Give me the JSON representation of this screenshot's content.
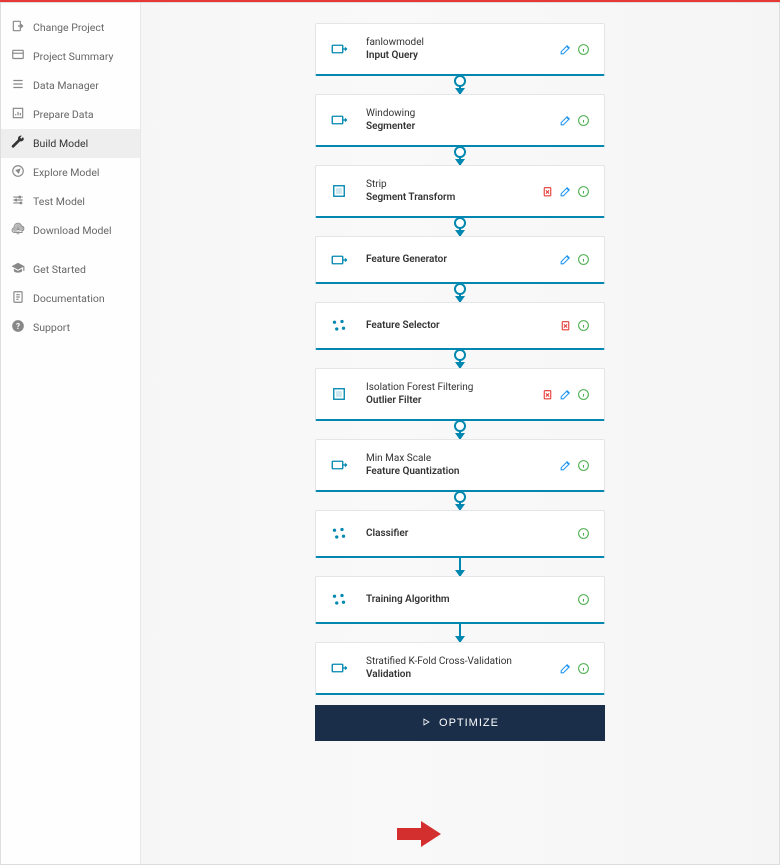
{
  "colors": {
    "accent": "#0288b0",
    "edit": "#2196f3",
    "info": "#4caf50",
    "delete": "#e53935",
    "button_bg": "#1a2e4a"
  },
  "sidebar": {
    "group1": [
      {
        "label": "Change Project",
        "icon": "change"
      },
      {
        "label": "Project Summary",
        "icon": "summary"
      },
      {
        "label": "Data Manager",
        "icon": "data"
      },
      {
        "label": "Prepare Data",
        "icon": "prepare"
      },
      {
        "label": "Build Model",
        "icon": "build",
        "active": true
      },
      {
        "label": "Explore Model",
        "icon": "explore"
      },
      {
        "label": "Test Model",
        "icon": "test"
      },
      {
        "label": "Download Model",
        "icon": "download"
      }
    ],
    "group2": [
      {
        "label": "Get Started",
        "icon": "grad"
      },
      {
        "label": "Documentation",
        "icon": "doc"
      },
      {
        "label": "Support",
        "icon": "support"
      }
    ]
  },
  "pipeline": [
    {
      "title": "fanlowmodel",
      "subtitle": "Input Query",
      "icon": "input",
      "actions": [
        "edit",
        "info"
      ],
      "dot": false
    },
    {
      "title": "Windowing",
      "subtitle": "Segmenter",
      "icon": "input",
      "actions": [
        "edit",
        "info"
      ],
      "dot": true
    },
    {
      "title": "Strip",
      "subtitle": "Segment Transform",
      "icon": "square",
      "actions": [
        "delete",
        "edit",
        "info"
      ],
      "dot": true
    },
    {
      "title": "Feature Generator",
      "subtitle": "",
      "icon": "input",
      "actions": [
        "edit",
        "info"
      ],
      "dot": true
    },
    {
      "title": "Feature Selector",
      "subtitle": "",
      "icon": "scatter",
      "actions": [
        "delete",
        "info"
      ],
      "dot": true
    },
    {
      "title": "Isolation Forest Filtering",
      "subtitle": "Outlier Filter",
      "icon": "square",
      "actions": [
        "delete",
        "edit",
        "info"
      ],
      "dot": true
    },
    {
      "title": "Min Max Scale",
      "subtitle": "Feature Quantization",
      "icon": "input",
      "actions": [
        "edit",
        "info"
      ],
      "dot": true
    },
    {
      "title": "Classifier",
      "subtitle": "",
      "icon": "scatter",
      "actions": [
        "info"
      ],
      "dot": true
    },
    {
      "title": "Training Algorithm",
      "subtitle": "",
      "icon": "scatter",
      "actions": [
        "info"
      ],
      "dot": false
    },
    {
      "title": "Stratified K-Fold Cross-Validation",
      "subtitle": "Validation",
      "icon": "input",
      "actions": [
        "edit",
        "info"
      ],
      "dot": false
    }
  ],
  "button": {
    "label": "OPTIMIZE"
  }
}
